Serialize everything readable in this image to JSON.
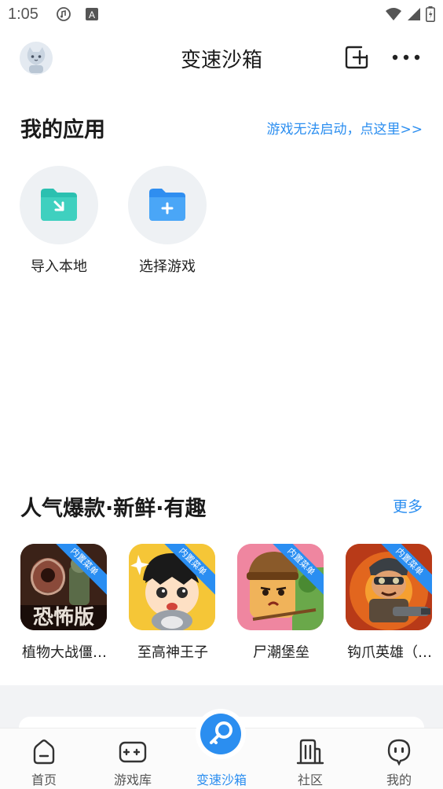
{
  "status_bar": {
    "time": "1:05",
    "icons": [
      "music-notification-icon",
      "a-notification-icon",
      "wifi-icon",
      "signal-icon",
      "battery-icon"
    ]
  },
  "header": {
    "title": "变速沙箱",
    "avatar_icon": "cat-avatar",
    "add_icon": "add-window-icon",
    "more_icon": "more-dots-icon"
  },
  "my_apps": {
    "title": "我的应用",
    "help_link": "游戏无法启动，点这里>>",
    "tiles": [
      {
        "label": "导入本地",
        "icon": "folder-import-icon",
        "color": "#2bc0b0"
      },
      {
        "label": "选择游戏",
        "icon": "folder-add-icon",
        "color": "#3a9cf5"
      }
    ]
  },
  "popular": {
    "title": "人气爆款·新鲜·有趣",
    "more_label": "更多",
    "badge_text": "内置菜单",
    "games": [
      {
        "name": "植物大战僵…"
      },
      {
        "name": "至高神王子"
      },
      {
        "name": "尸潮堡垒"
      },
      {
        "name": "钩爪英雄（…"
      }
    ]
  },
  "bottom_nav": {
    "items": [
      {
        "label": "首页",
        "icon": "home-icon",
        "active": false
      },
      {
        "label": "游戏库",
        "icon": "gamepad-icon",
        "active": false
      },
      {
        "label": "变速沙箱",
        "icon": "sandbox-key-icon",
        "active": true
      },
      {
        "label": "社区",
        "icon": "community-building-icon",
        "active": false
      },
      {
        "label": "我的",
        "icon": "profile-face-icon",
        "active": false
      }
    ]
  },
  "colors": {
    "accent": "#2b8ef0",
    "teal": "#2bc0b0",
    "background": "#ffffff",
    "band": "#f2f3f5"
  }
}
